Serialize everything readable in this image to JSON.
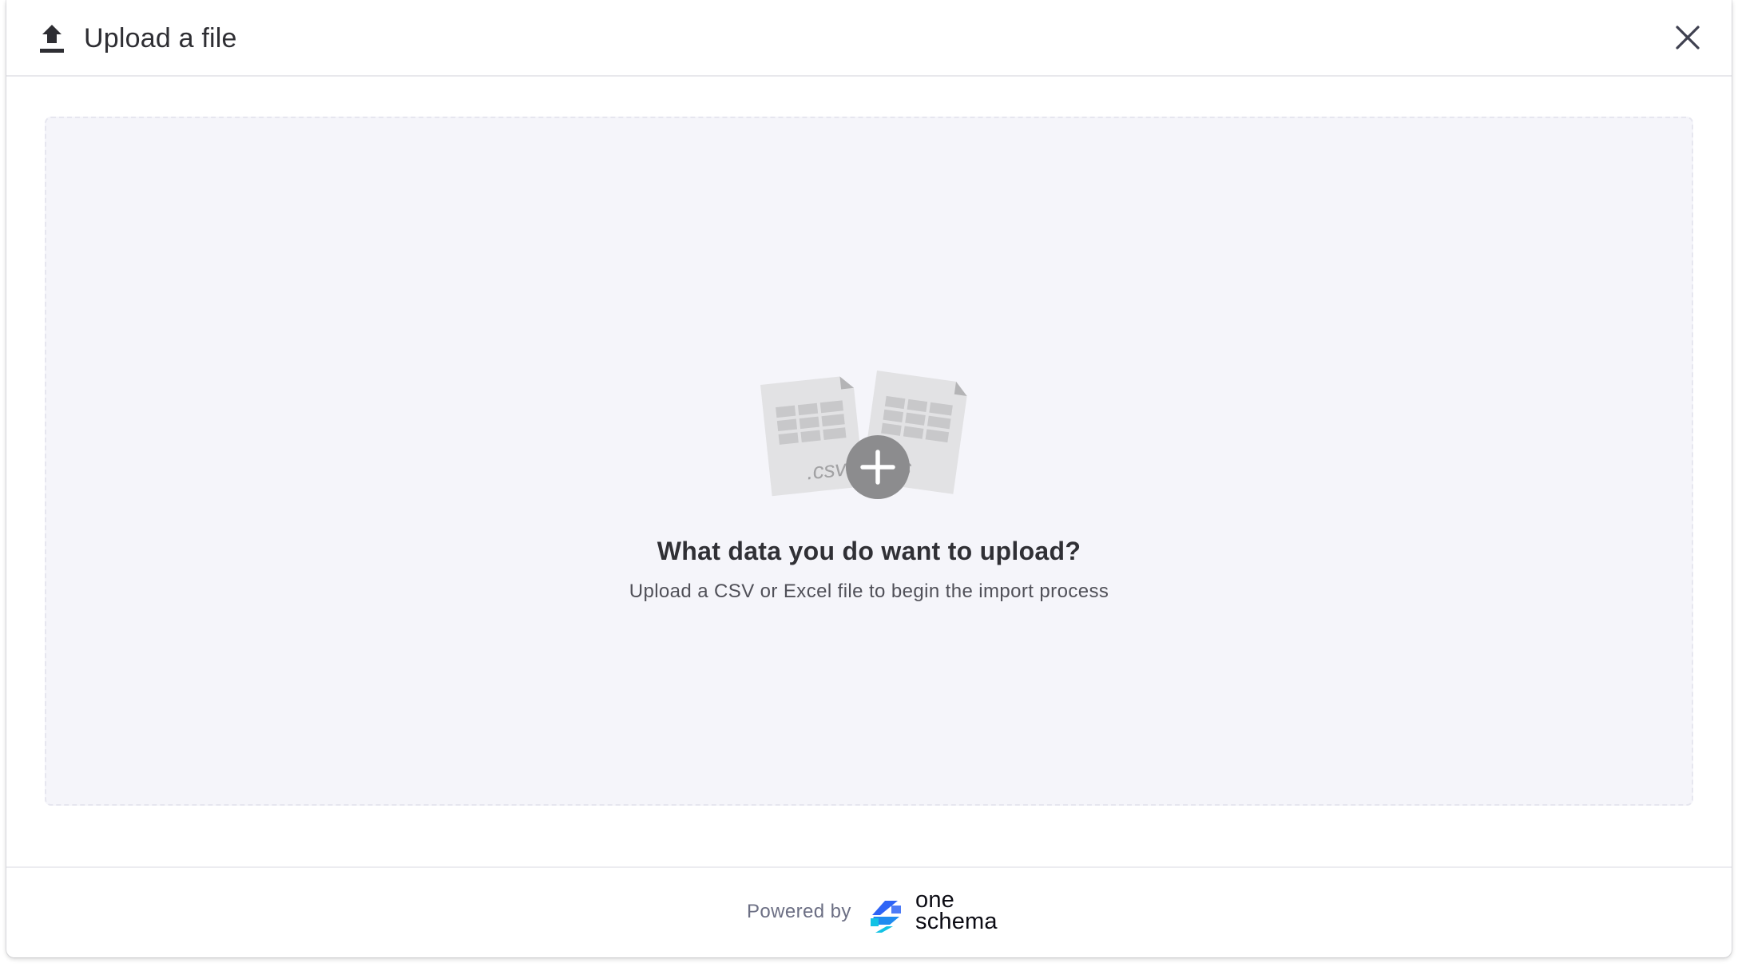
{
  "header": {
    "title": "Upload a file",
    "upload_icon": "upload-arrow-icon",
    "close_icon": "close-x-icon"
  },
  "dropzone": {
    "file_labels": [
      ".csv",
      ".xls"
    ],
    "add_icon": "plus-circle-icon",
    "heading": "What data you do want to upload?",
    "subtext": "Upload a CSV or Excel file to begin the import process"
  },
  "footer": {
    "powered_by": "Powered by",
    "brand_line1": "one",
    "brand_line2": "schema"
  },
  "colors": {
    "dropzone_bg": "#f5f5fa",
    "file_icon": "#e2e2e4",
    "grid_cell": "#c8c8ca",
    "plus_circle": "#8c8c8e",
    "brand_blue": "#2e64f6",
    "brand_cyan": "#13c2e4"
  }
}
